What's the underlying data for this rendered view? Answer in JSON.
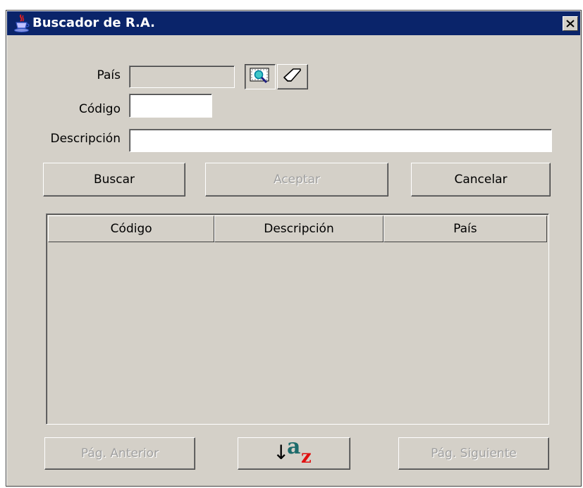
{
  "window": {
    "title": "Buscador de R.A.",
    "close_label": "×"
  },
  "form": {
    "pais": {
      "label": "País",
      "value": ""
    },
    "codigo": {
      "label": "Código",
      "value": ""
    },
    "descripcion": {
      "label": "Descripción",
      "value": ""
    }
  },
  "buttons": {
    "buscar": "Buscar",
    "aceptar": "Aceptar",
    "cancelar": "Cancelar",
    "prev_page": "Pág. Anterior",
    "next_page": "Pág. Siguiente"
  },
  "table": {
    "columns": [
      "Código",
      "Descripción",
      "País"
    ],
    "rows": []
  },
  "sort_button": {
    "letter_top": "a",
    "letter_bottom": "z",
    "arrow": "↓"
  },
  "icons": {
    "title": "java-cup-icon",
    "lookup": "search-lookup-icon",
    "clear": "eraser-icon",
    "close": "close-icon"
  },
  "colors": {
    "titlebar": "#0a246a",
    "face": "#d4d0c8",
    "sort_a": "#1d6b6b",
    "sort_z": "#e01010"
  }
}
